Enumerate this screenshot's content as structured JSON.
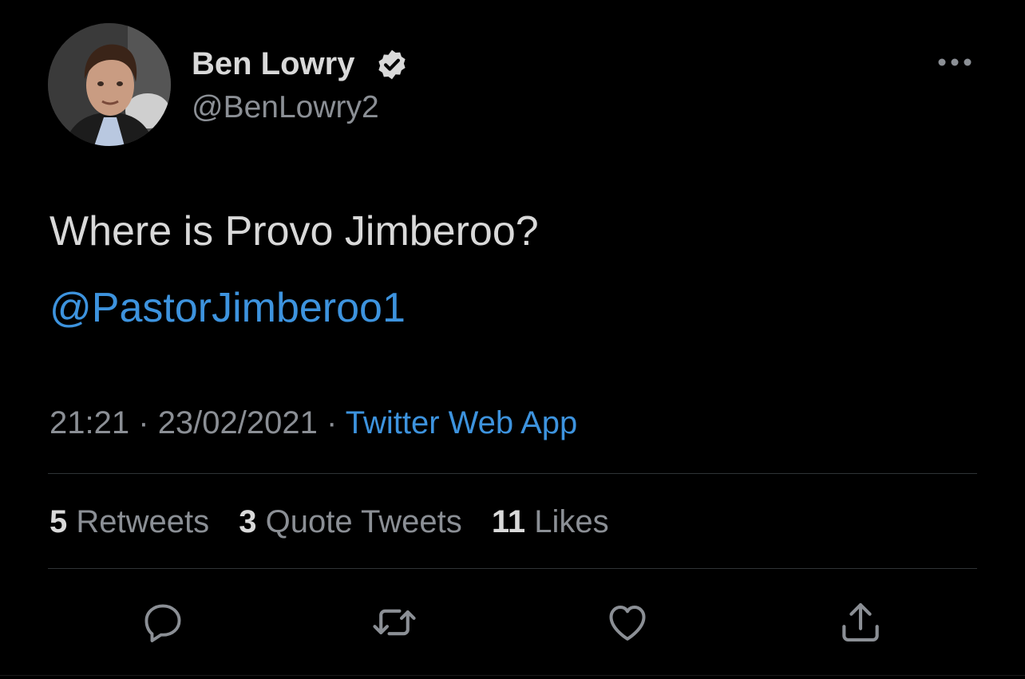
{
  "author": {
    "name": "Ben Lowry",
    "handle": "@BenLowry2",
    "verified": true
  },
  "tweet": {
    "text": "Where is Provo Jimberoo?",
    "mention": "@PastorJimberoo1",
    "time": "21:21",
    "date": "23/02/2021",
    "source": "Twitter Web App",
    "separator": "·"
  },
  "stats": {
    "retweets_count": "5",
    "retweets_label": "Retweets",
    "quotes_count": "3",
    "quotes_label": "Quote Tweets",
    "likes_count": "11",
    "likes_label": "Likes"
  },
  "icons": {
    "more": "more-horizontal-icon",
    "reply": "reply-icon",
    "retweet": "retweet-icon",
    "like": "heart-icon",
    "share": "share-icon",
    "verified": "verified-badge-icon"
  },
  "colors": {
    "background": "#000000",
    "text": "#d9d9d9",
    "secondary": "#8b8f95",
    "accent": "#3d93de",
    "divider": "#2f3336"
  }
}
